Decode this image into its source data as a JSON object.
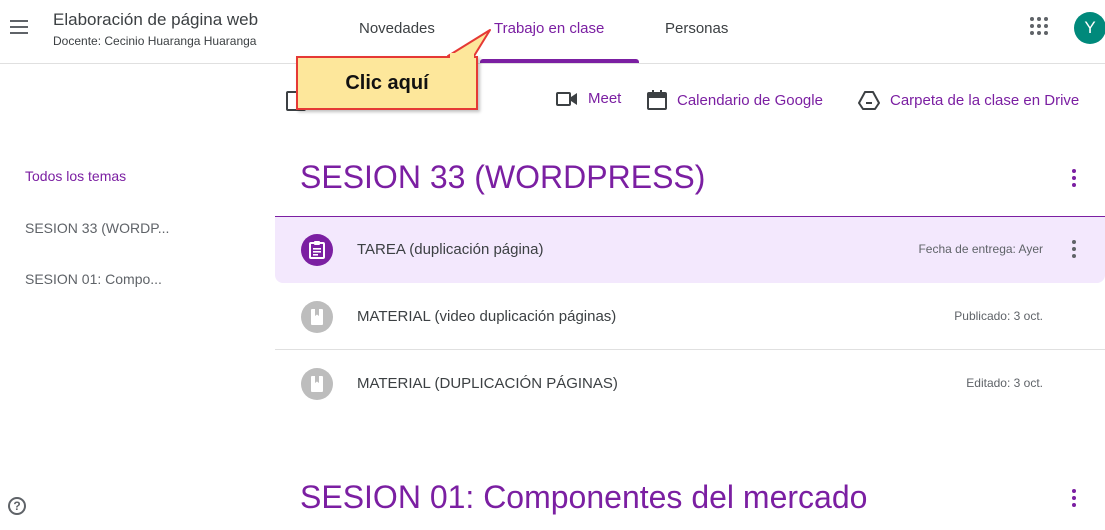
{
  "header": {
    "class_title": "Elaboración de página web",
    "teacher": "Docente: Cecinio Huaranga Huaranga",
    "tabs": [
      {
        "label": "Novedades"
      },
      {
        "label": "Trabajo en clase"
      },
      {
        "label": "Personas"
      }
    ],
    "active_tab": "Trabajo en clase",
    "avatar_initial": "Y",
    "avatar_color": "#00897b"
  },
  "toolbar": {
    "meet_label": "Meet",
    "calendar_label": "Calendario de Google",
    "drive_label": "Carpeta de la clase en Drive"
  },
  "annotation": {
    "callout_text": "Clic aquí"
  },
  "sidebar": {
    "items": [
      {
        "label": "Todos los temas",
        "active": true
      },
      {
        "label": "SESION 33 (WORDP...",
        "active": false
      },
      {
        "label": "SESION 01: Compo...",
        "active": false
      }
    ]
  },
  "topics": [
    {
      "title": "SESION 33 (WORDPRESS)",
      "items": [
        {
          "type": "assignment",
          "title": "TAREA (duplicación página)",
          "meta": "Fecha de entrega: Ayer"
        },
        {
          "type": "material",
          "title": "MATERIAL (video duplicación páginas)",
          "meta": "Publicado: 3 oct."
        },
        {
          "type": "material",
          "title": "MATERIAL (DUPLICACIÓN PÁGINAS)",
          "meta": "Editado: 3 oct."
        }
      ]
    },
    {
      "title": "SESION 01: Componentes del mercado",
      "items": []
    }
  ],
  "colors": {
    "accent": "#7b1fa2",
    "highlight_bg": "#f3e8fd",
    "callout_bg": "#fde79b",
    "callout_border": "#e53935"
  },
  "icons": {
    "menu": "hamburger-menu-icon",
    "apps": "apps-grid-icon",
    "meet": "video-camera-icon",
    "calendar": "calendar-icon",
    "drive": "google-drive-icon",
    "help": "help-icon",
    "assignment": "assignment-icon",
    "material": "material-icon"
  }
}
